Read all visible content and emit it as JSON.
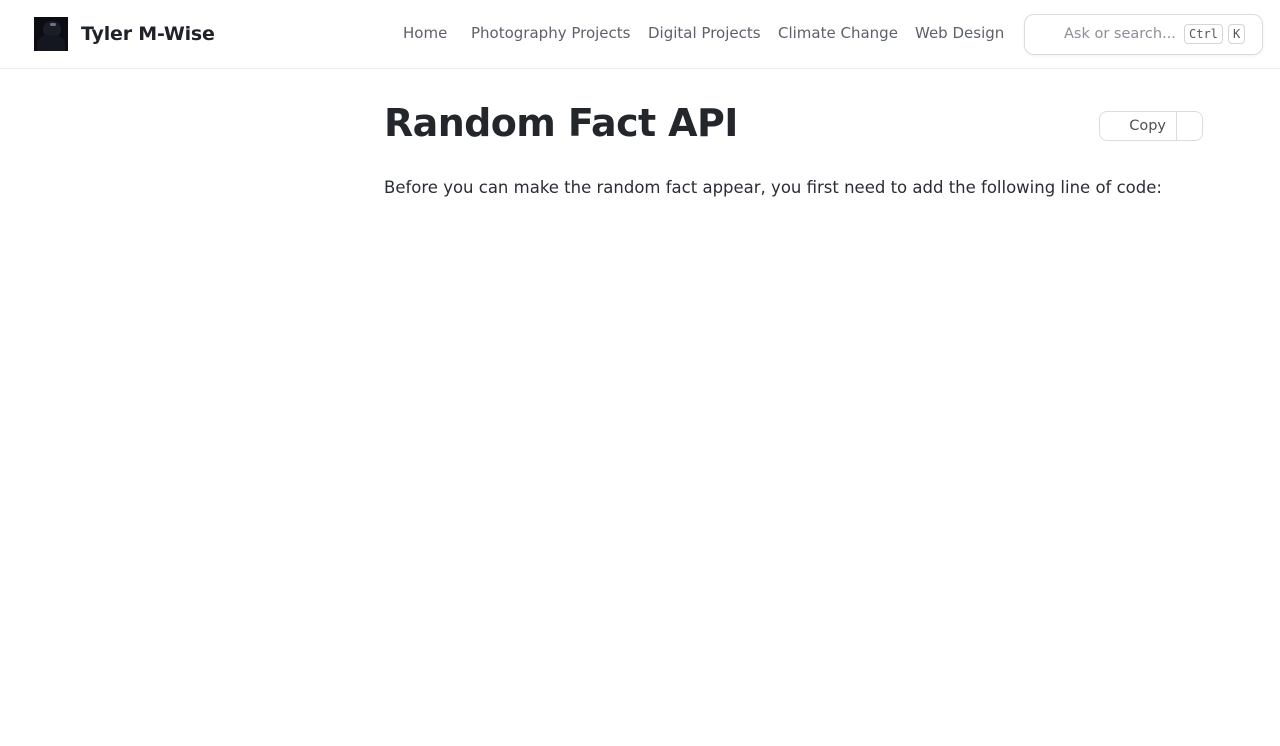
{
  "header": {
    "brand_name": "Tyler M-Wise",
    "nav": [
      {
        "label": "Home"
      },
      {
        "label": "Photography Projects"
      },
      {
        "label": "Digital Projects"
      },
      {
        "label": "Climate Change"
      },
      {
        "label": "Web Design"
      }
    ],
    "search": {
      "placeholder": "Ask or search...",
      "shortcut_key1": "Ctrl",
      "shortcut_key2": "K"
    }
  },
  "main": {
    "title": "Random Fact API",
    "copy_label": "Copy",
    "intro": "Before you can make the random fact appear, you first need to add the following line of code:"
  }
}
